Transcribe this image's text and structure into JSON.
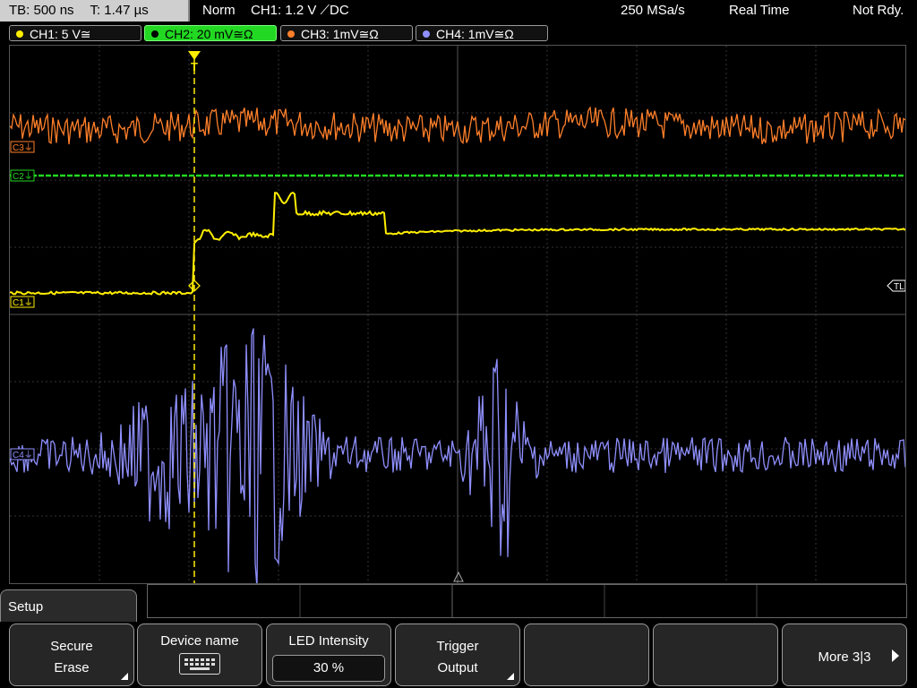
{
  "header": {
    "timebase": "TB: 500 ns",
    "trigger_time": "T: 1.47 µs",
    "acq_mode": "Norm",
    "trigger_info": "CH1: 1.2 V ⟋DC",
    "sample_rate": "250 MSa/s",
    "mode": "Real Time",
    "status": "Not Rdy."
  },
  "channels": [
    {
      "label": "CH1: 5 V≅",
      "color": "#ffee00"
    },
    {
      "label": "CH2: 20 mV≅Ω",
      "color": "#22d822"
    },
    {
      "label": "CH3: 1mV≅Ω",
      "color": "#ff7f2a"
    },
    {
      "label": "CH4: 1mV≅Ω",
      "color": "#8f8fff"
    }
  ],
  "markers": {
    "c3": "C3⏚",
    "c2": "C2⏚",
    "c1": "C1⏚",
    "c4": "C4⏚",
    "trigger_level": "TL",
    "trigger_pos": "T"
  },
  "menu": {
    "title": "Setup",
    "softkeys": [
      {
        "line1": "Secure",
        "line2": "Erase"
      },
      {
        "line1": "Device name"
      },
      {
        "line1": "LED Intensity",
        "value": "30 %"
      },
      {
        "line1": "Trigger",
        "line2": "Output"
      },
      {},
      {},
      {
        "line1": "More 3|3"
      }
    ]
  },
  "icons": [
    "keyboard-icon",
    "submenu-corner-icon",
    "next-arrow-icon"
  ]
}
